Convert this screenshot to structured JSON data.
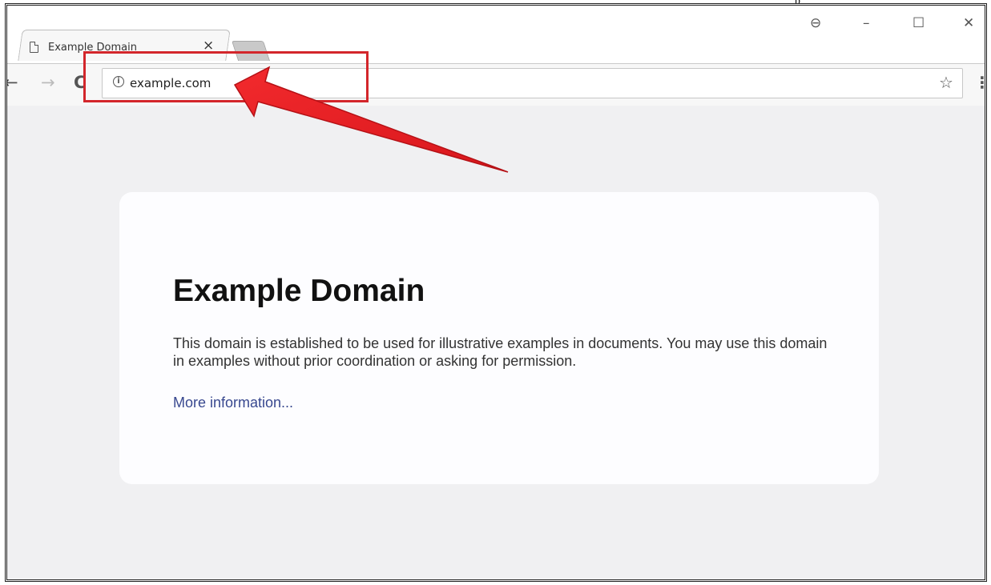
{
  "browser": {
    "tab_title": "Example Domain",
    "tab_close": "×",
    "window_controls": {
      "account": "⊖",
      "minimize": "–",
      "maximize": "☐",
      "close": "✕"
    },
    "nav": {
      "back": "←",
      "forward": "→",
      "reload": "C"
    },
    "address": "example.com",
    "info_icon": "i",
    "bookmark_icon": "☆",
    "menu_icon": "⋮"
  },
  "page": {
    "heading": "Example Domain",
    "paragraph": "This domain is established to be used for illustrative examples in documents. You may use this domain in examples without prior coordination or asking for permission.",
    "link": "More information..."
  },
  "annotation": {
    "highlight_color": "#d3262b",
    "arrow_color": "#e51f24"
  },
  "fragment": {
    "text": "p"
  }
}
